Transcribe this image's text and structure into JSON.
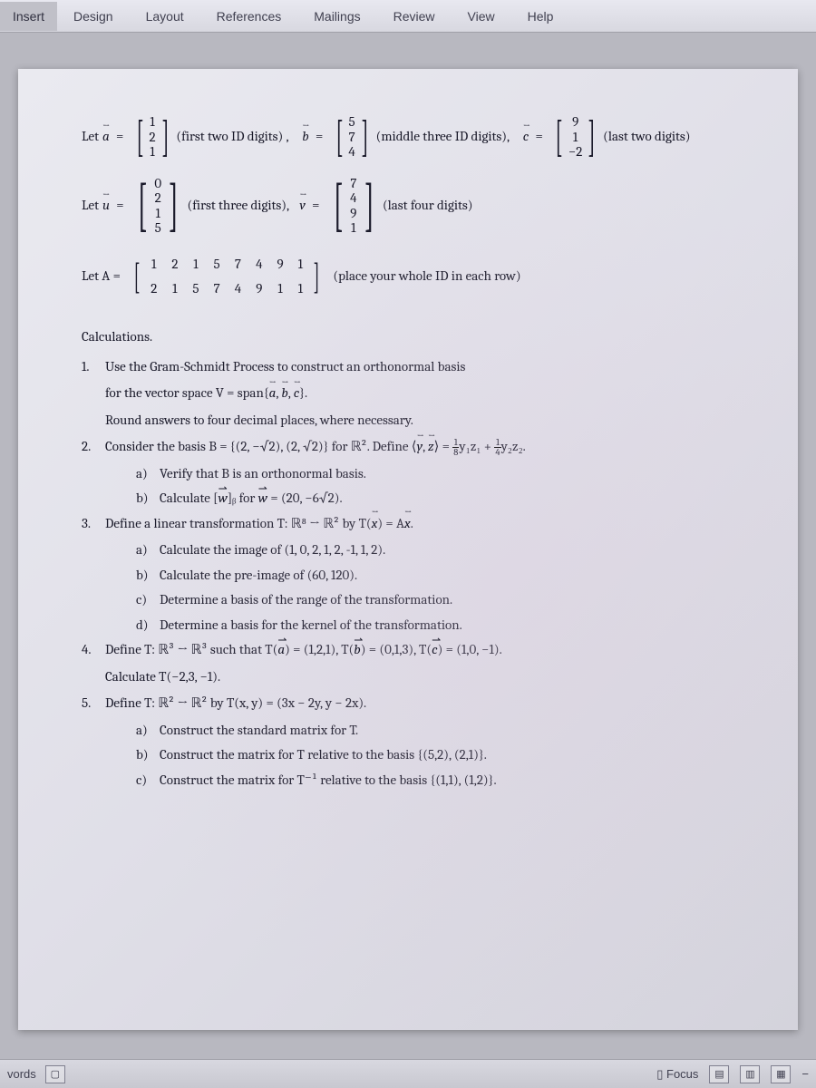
{
  "ribbon": {
    "tabs": [
      "Insert",
      "Design",
      "Layout",
      "References",
      "Mailings",
      "Review",
      "View",
      "Help"
    ]
  },
  "definitions": {
    "a_label": "Let ",
    "a_vec": "a",
    "a_values": [
      "1",
      "2",
      "1"
    ],
    "a_note": "(first two ID digits) ,",
    "b_vec": "b",
    "b_values": [
      "5",
      "7",
      "4"
    ],
    "b_note": "(middle three ID digits),",
    "c_vec": "c",
    "c_values": [
      "9",
      "1",
      "−2"
    ],
    "c_note": "(last two digits)",
    "u_label": "Let ",
    "u_vec": "u",
    "u_values": [
      "0",
      "2",
      "1",
      "5"
    ],
    "u_note": "(first three digits),",
    "v_vec": "v",
    "v_values": [
      "7",
      "4",
      "9",
      "1"
    ],
    "v_note": "(last four digits)",
    "A_label": "Let A =",
    "A_row1": [
      "1",
      "2",
      "1",
      "5",
      "7",
      "4",
      "9",
      "1"
    ],
    "A_row2": [
      "2",
      "1",
      "5",
      "7",
      "4",
      "9",
      "1",
      "1"
    ],
    "A_note": "(place your whole ID in each row)"
  },
  "calc_header": "Calculations.",
  "problems": {
    "p1_line1": "Use the Gram-Schmidt Process to construct an orthonormal basis",
    "p1_line2_a": "for the vector space V = span{",
    "p1_line2_b": "}.",
    "p1_line3": "Round answers to four decimal places, where necessary.",
    "p2_a": "Consider the basis B = {(2, −√2), (2, √2)} for ℝ².  Define ⟨",
    "p2_b": "⟩ = ",
    "p2_c": "y₁z₁ + ",
    "p2_d": "y₂z₂.",
    "p2a": "Verify that B is an orthonormal basis.",
    "p2b_a": "Calculate [",
    "p2b_b": "]ᵦ for ",
    "p2b_c": " = (20, −6√2).",
    "p3_a": "Define a linear transformation T: ℝ⁸ → ℝ² by T(",
    "p3_b": ") = A",
    "p3_c": ".",
    "p3a": "Calculate the image of (1, 0, 2, 1, 2, -1, 1, 2).",
    "p3b": "Calculate the pre-image of (60, 120).",
    "p3c": "Determine a basis of the range of the transformation.",
    "p3d": "Determine a basis for the kernel of the transformation.",
    "p4_a": "Define T: ℝ³ → ℝ³ such that T(",
    "p4_b": ") = (1,2,1),  T(",
    "p4_c": ") = (0,1,3), T(",
    "p4_d": ") = (1,0, −1).",
    "p4_line2": "Calculate T(−2,3, −1).",
    "p5": "Define T: ℝ² → ℝ² by T(x, y) = (3x − 2y, y − 2x).",
    "p5a": "Construct the standard matrix for T.",
    "p5b": "Construct the matrix for T relative to the basis {(5,2), (2,1)}.",
    "p5c": "Construct the matrix for T⁻¹ relative to the basis {(1,1), (1,2)}."
  },
  "statusbar": {
    "words": "vords",
    "focus": "Focus"
  }
}
